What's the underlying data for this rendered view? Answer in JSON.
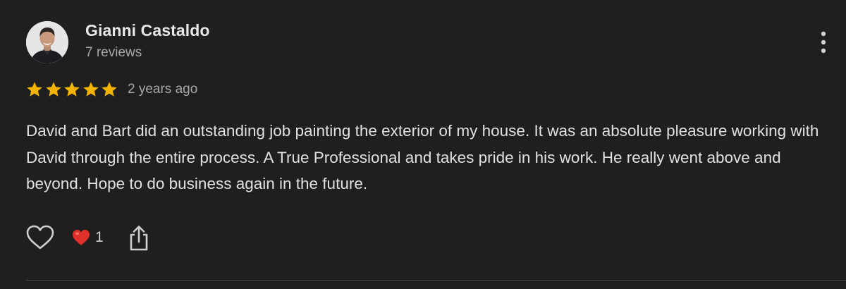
{
  "review": {
    "author": {
      "name": "Gianni Castaldo",
      "review_count": "7 reviews",
      "avatar": "profile photo"
    },
    "rating": {
      "stars": 5,
      "max_stars": 5,
      "star_color": "#f2b400"
    },
    "date": "2 years ago",
    "text": "David and Bart did an outstanding job painting the exterior of my house. It was an absolute pleasure working with David through the entire process. A True Professional and takes pride in his work. He really went above and beyond. Hope to do business again in the future.",
    "actions": {
      "like_icon": "heart-outline-icon",
      "reaction_icon": "red-heart-icon",
      "reaction_count": "1",
      "share_icon": "share-icon",
      "more_icon": "more-vert-icon"
    }
  },
  "colors": {
    "background": "#1f1f1f",
    "text": "#e0e0e0",
    "muted_text": "#a8a8a8",
    "reaction_heart": "#e0302a"
  }
}
